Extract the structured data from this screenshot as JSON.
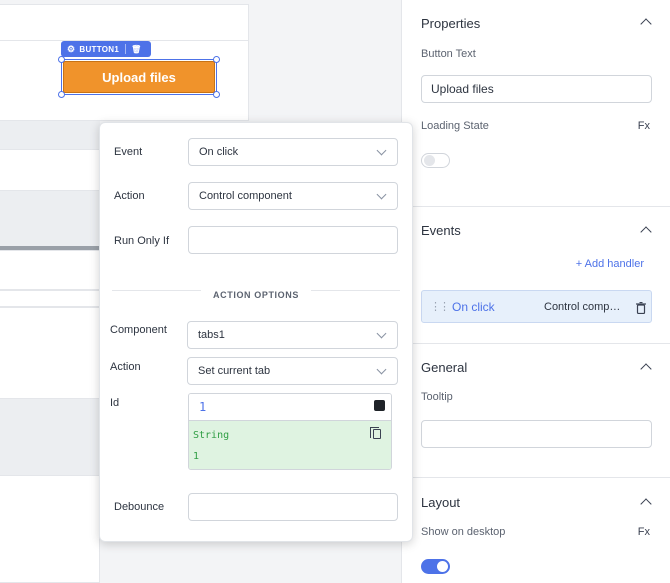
{
  "canvas": {
    "badge_label": "BUTTON1",
    "button_text": "Upload files",
    "colors": {
      "button": "#f0932b",
      "selection": "#4d72e8"
    }
  },
  "panel": {
    "properties": {
      "title": "Properties",
      "button_text_label": "Button Text",
      "button_text_value": "Upload files",
      "loading_state_label": "Loading State",
      "fx_label": "Fx",
      "loading_state_on": false
    },
    "events": {
      "title": "Events",
      "add_handler": "+ Add handler",
      "handler": {
        "event": "On click",
        "action": "Control component..."
      }
    },
    "general": {
      "title": "General",
      "tooltip_label": "Tooltip",
      "tooltip_value": ""
    },
    "layout": {
      "title": "Layout",
      "show_on_desktop_label": "Show on desktop",
      "fx_label": "Fx",
      "show_on_desktop_on": true
    }
  },
  "popover": {
    "event_label": "Event",
    "event_value": "On click",
    "action_label": "Action",
    "action_value": "Control component",
    "run_only_if_label": "Run Only If",
    "run_only_if_value": "",
    "action_options_heading": "ACTION OPTIONS",
    "component_label": "Component",
    "component_value": "tabs1",
    "option_action_label": "Action",
    "option_action_value": "Set current tab",
    "id_label": "Id",
    "id_value": "1",
    "id_type": "String",
    "id_preview": "1",
    "debounce_label": "Debounce",
    "debounce_value": ""
  }
}
